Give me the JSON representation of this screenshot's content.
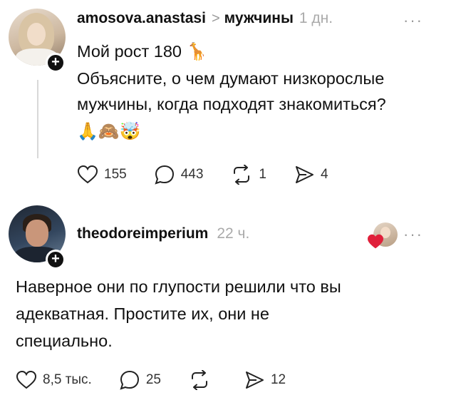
{
  "post1": {
    "username": "amosova.anastasi",
    "chevron": ">",
    "topic": "мужчины",
    "time": "1 дн.",
    "more_label": "···",
    "line1": "Мой рост 180",
    "line1_emoji": "🦒",
    "line2": "Объясните, о чем думают низкорослые",
    "line3": "мужчины, когда подходят знакомиться?",
    "emoji_line": "🙏🙈🤯",
    "likes": "155",
    "comments": "443",
    "reposts": "1",
    "shares": "4"
  },
  "post2": {
    "username": "theodoreimperium",
    "time": "22 ч.",
    "more_label": "···",
    "line1": "Наверное они по глупости решили что вы",
    "line2": "адекватная. Простите их, они не",
    "line3": "специально.",
    "likes": "8,5 тыс.",
    "comments": "25",
    "reposts": "",
    "shares": "12"
  },
  "colors": {
    "text": "#111111",
    "muted": "#aaaaaa",
    "heart": "#e0203a",
    "badge": "#111111"
  },
  "icons": [
    "heart-icon",
    "comment-icon",
    "repost-icon",
    "share-icon",
    "plus-icon",
    "more-icon"
  ]
}
